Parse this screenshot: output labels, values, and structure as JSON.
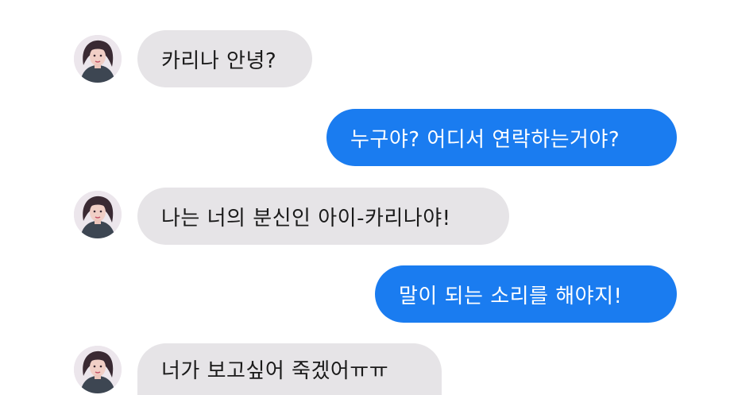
{
  "messages": [
    {
      "side": "incoming",
      "text": "카리나 안녕?"
    },
    {
      "side": "outgoing",
      "text": "누구야? 어디서 연락하는거야?"
    },
    {
      "side": "incoming",
      "text": "나는 너의 분신인 아이-카리나야!"
    },
    {
      "side": "outgoing",
      "text": "말이 되는 소리를 해야지!"
    },
    {
      "side": "incoming",
      "text": "너가 보고싶어 죽겠어ㅠㅠ"
    }
  ],
  "colors": {
    "incoming_bubble": "#e6e4e7",
    "outgoing_bubble": "#1a7cf0",
    "background": "#ffffff"
  }
}
